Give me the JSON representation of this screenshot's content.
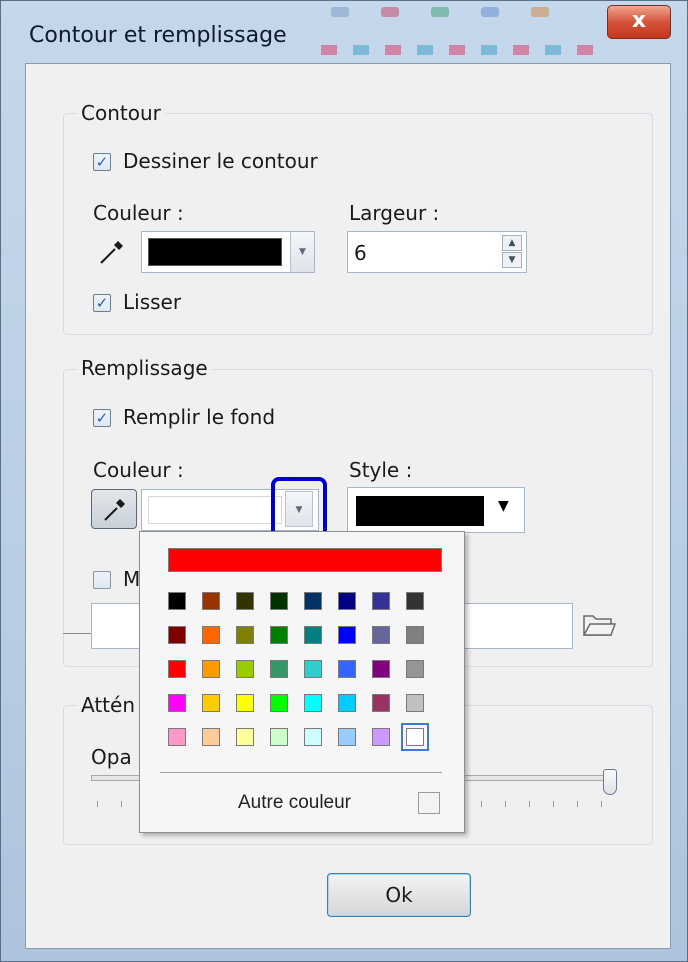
{
  "window": {
    "title": "Contour et remplissage",
    "close_glyph": "x"
  },
  "contour": {
    "legend": "Contour",
    "draw_label": "Dessiner le contour",
    "draw_checked": true,
    "color_label": "Couleur :",
    "color_value": "#000000",
    "width_label": "Largeur :",
    "width_value": "6",
    "smooth_label": "Lisser",
    "smooth_checked": true
  },
  "fill": {
    "legend": "Remplissage",
    "fill_label": "Remplir le fond",
    "fill_checked": true,
    "color_label": "Couleur :",
    "color_value": "#ffffff",
    "style_label": "Style :",
    "style_value": "#000000",
    "partial_checkbox_label": "M",
    "partial_checked": false
  },
  "attenuation": {
    "legend": "Attén",
    "opacity_label": "Opa"
  },
  "palette": {
    "top_color": "#ff0000",
    "rows": [
      [
        "#000000",
        "#993300",
        "#333300",
        "#003300",
        "#003366",
        "#000080",
        "#333399",
        "#333333"
      ],
      [
        "#800000",
        "#ff6600",
        "#808000",
        "#008000",
        "#008080",
        "#0000ff",
        "#666699",
        "#808080"
      ],
      [
        "#ff0000",
        "#ff9900",
        "#99cc00",
        "#339966",
        "#33cccc",
        "#3366ff",
        "#800080",
        "#969696"
      ],
      [
        "#ff00ff",
        "#ffcc00",
        "#ffff00",
        "#00ff00",
        "#00ffff",
        "#00ccff",
        "#993366",
        "#c0c0c0"
      ],
      [
        "#ff99cc",
        "#ffcc99",
        "#ffff99",
        "#ccffcc",
        "#ccffff",
        "#99ccff",
        "#cc99ff",
        "#ffffff"
      ]
    ],
    "more_label": "Autre couleur"
  },
  "ok_label": "Ok",
  "highlight_color": "#0000cc"
}
